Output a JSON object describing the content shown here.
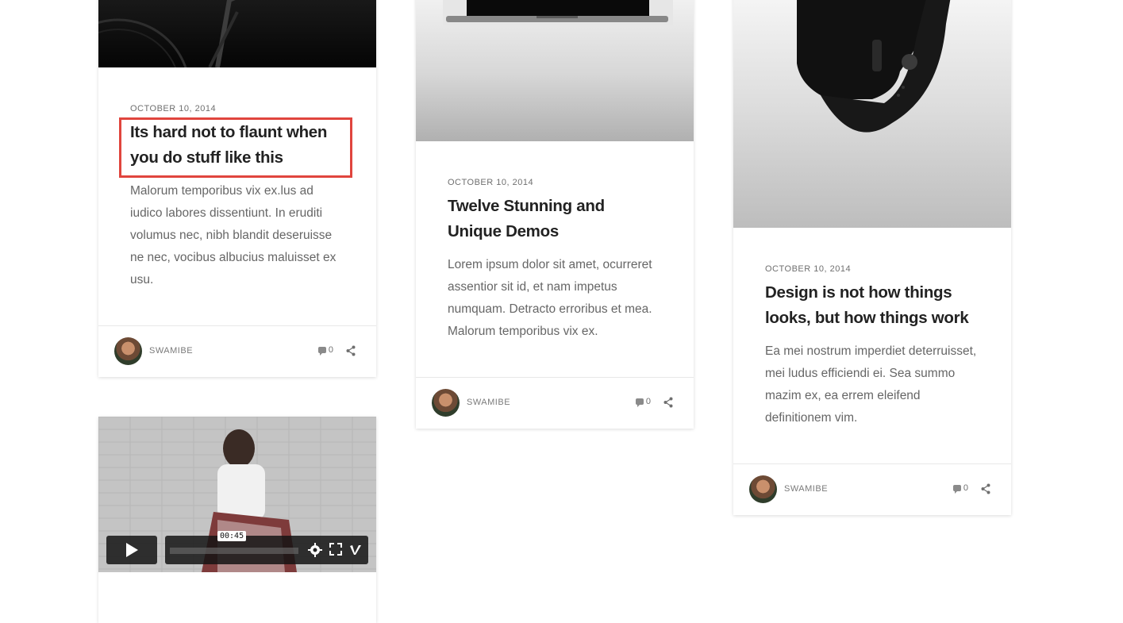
{
  "cards": [
    {
      "date": "October 10, 2014",
      "title": "Its hard not to flaunt when you do stuff like this",
      "excerpt": "Malorum temporibus vix ex.lus ad iudico labores dissentiunt. In eruditi volumus nec, nibh blandit deseruisse ne nec, vocibus albucius maluisset ex usu.",
      "author": "SWAMIBE",
      "comments": "0"
    },
    {
      "date": "October 10, 2014",
      "title": "Twelve Stunning and Unique Demos",
      "excerpt": "Lorem ipsum dolor sit amet, ocurreret assentior sit id, et nam impetus numquam. Detracto erroribus et mea. Malorum temporibus vix ex.",
      "author": "SWAMIBE",
      "comments": "0"
    },
    {
      "date": "October 10, 2014",
      "title": "Design is not how things looks, but how things work",
      "excerpt": "Ea mei nostrum imperdiet deterruisset, mei ludus efficiendi ei. Sea summo mazim ex, ea errem eleifend definitionem vim.",
      "author": "SWAMIBE",
      "comments": "0"
    }
  ],
  "video": {
    "time": "00:45",
    "icons": [
      "play-icon",
      "gear-icon",
      "fullscreen-icon",
      "vimeo-icon"
    ]
  },
  "colors": {
    "highlight": "#e0453e",
    "title": "#222222",
    "text": "#666666"
  }
}
